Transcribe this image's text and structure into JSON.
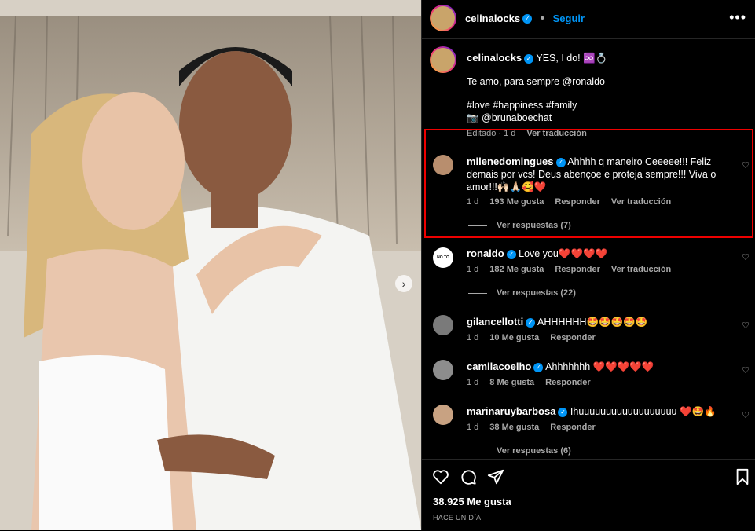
{
  "header": {
    "username": "celinalocks",
    "follow_label": "Seguir",
    "more_icon": "more-horizontal-icon"
  },
  "caption": {
    "username": "celinalocks",
    "line1": "YES, I do! ♾️💍",
    "line2": "Te amo, para sempre @ronaldo",
    "line3": "#love #happiness #family",
    "line4": "📷 @brunaboechat",
    "edited": "Editado · 1 d",
    "translate": "Ver traducción"
  },
  "comments": [
    {
      "username": "milenedomingues",
      "verified": true,
      "text": "Ahhhh q maneiro Ceeeee!!! Feliz demais por vcs! Deus abençoe e proteja sempre!!! Viva o amor!!!🙌🏻🙏🏻🥰❤️",
      "time": "1 d",
      "likes": "193 Me gusta",
      "reply": "Responder",
      "translate": "Ver traducción",
      "replies": "Ver respuestas (7)"
    },
    {
      "username": "ronaldo",
      "verified": true,
      "text": "Love you❤️❤️❤️❤️",
      "time": "1 d",
      "likes": "182 Me gusta",
      "reply": "Responder",
      "translate": "Ver traducción",
      "replies": "Ver respuestas (22)"
    },
    {
      "username": "gilancellotti",
      "verified": true,
      "text": "AHHHHHH🤩🤩🤩🤩🤩",
      "time": "1 d",
      "likes": "10 Me gusta",
      "reply": "Responder"
    },
    {
      "username": "camilacoelho",
      "verified": true,
      "text": "Ahhhhhhh ❤️❤️❤️❤️❤️",
      "time": "1 d",
      "likes": "8 Me gusta",
      "reply": "Responder"
    },
    {
      "username": "marinaruybarbosa",
      "verified": true,
      "text": "Ihuuuuuuuuuuuuuuuuuu ❤️🤩🔥",
      "time": "1 d",
      "likes": "38 Me gusta",
      "reply": "Responder",
      "replies": "Ver respuestas (6)"
    }
  ],
  "footer": {
    "likes": "38.925 Me gusta",
    "when": "HACE UN DÍA"
  },
  "colors": {
    "accent": "#0095f6",
    "highlight": "#ee0000",
    "muted": "#a8a8a8"
  }
}
